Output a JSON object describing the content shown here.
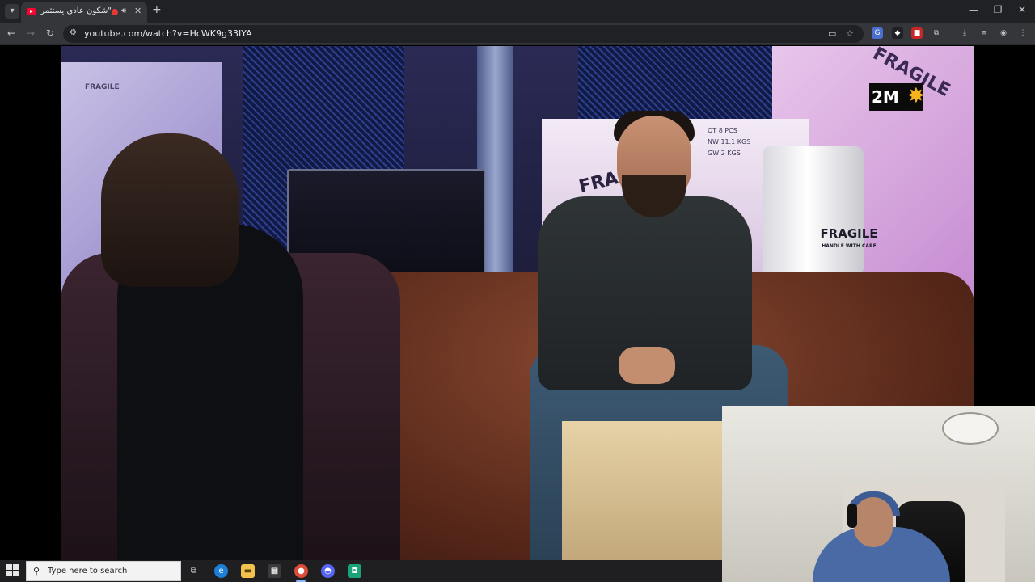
{
  "browser": {
    "tab": {
      "title": "\"شكون عادي يستثمر فمنا",
      "audio_icon": "speaker-icon",
      "close_icon": "close-icon"
    },
    "new_tab_icon": "plus-icon",
    "window_controls": [
      "minimize-icon",
      "restore-icon",
      "close-icon"
    ],
    "address": {
      "url": "youtube.com/watch?v=HcWK9g33IYA"
    },
    "accent": "#8ab4f8"
  },
  "video": {
    "channel_logo": "2M",
    "set_text": {
      "fragile_left": "FRAGILE",
      "fragile_box": "FRAGILE",
      "box_specs": [
        "QT   8  PCS",
        "NW  11.1 KGS",
        "GW   2  KGS"
      ],
      "barrel_main": "FRAGILE",
      "barrel_sub": "HANDLE WITH CARE",
      "fragile_corner": "FRAGILE"
    }
  },
  "taskbar": {
    "search_placeholder": "Type here to search",
    "apps": [
      "task-view-icon",
      "edge-icon",
      "file-explorer-icon",
      "store-icon",
      "chrome-icon",
      "discord-icon",
      "app-icon"
    ]
  }
}
